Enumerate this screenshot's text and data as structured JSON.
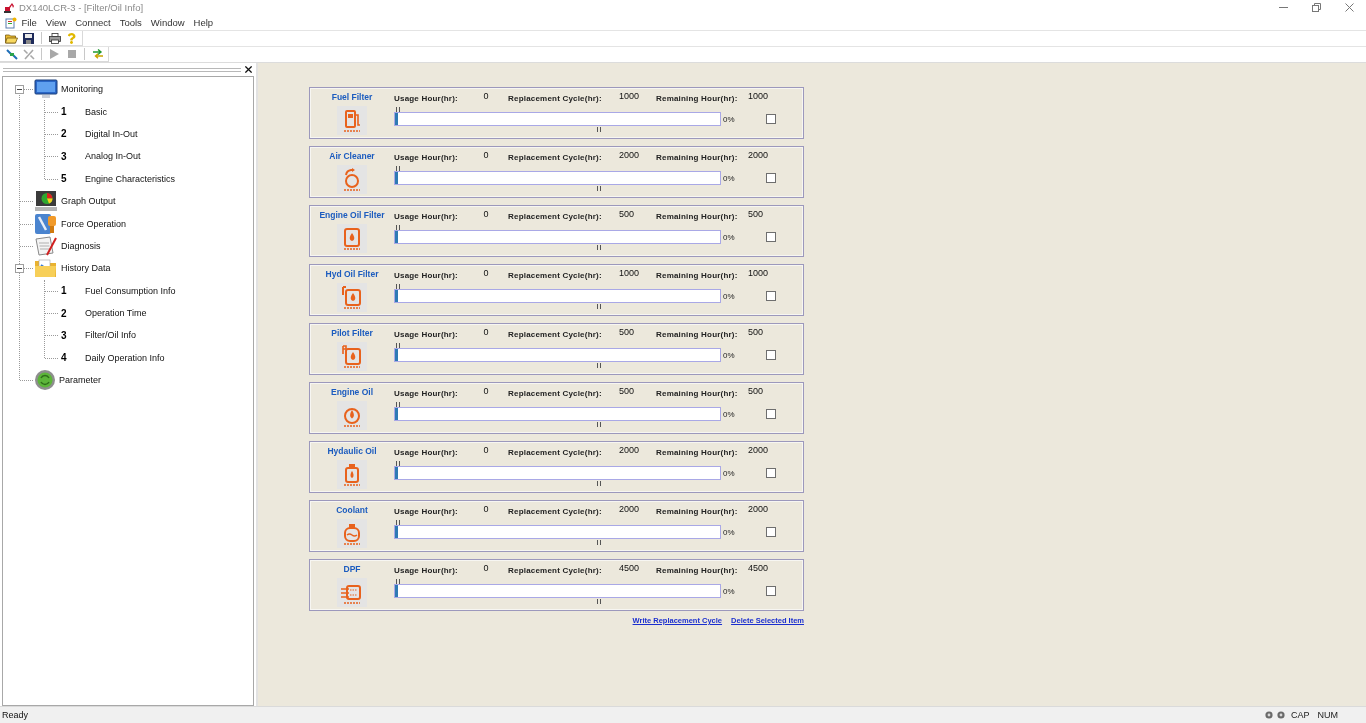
{
  "window": {
    "title": "DX140LCR-3 - [Filter/Oil Info]"
  },
  "menu": [
    "File",
    "View",
    "Connect",
    "Tools",
    "Window",
    "Help"
  ],
  "toolbar": {
    "buttons": [
      {
        "disabled": false
      },
      {
        "disabled": true
      },
      {
        "disabled": true
      },
      {
        "disabled": true
      },
      {
        "disabled": false
      }
    ]
  },
  "sidebar": {
    "tree": [
      {
        "label": "Monitoring",
        "expanded": true,
        "children": [
          {
            "number": "1",
            "label": "Basic"
          },
          {
            "number": "2",
            "label": "Digital In-Out"
          },
          {
            "number": "3",
            "label": "Analog In-Out"
          },
          {
            "number": "5",
            "label": "Engine Characteristics"
          }
        ]
      },
      {
        "label": "Graph Output"
      },
      {
        "label": "Force Operation"
      },
      {
        "label": "Diagnosis"
      },
      {
        "label": "History Data",
        "expanded": true,
        "children": [
          {
            "number": "1",
            "label": "Fuel Consumption Info"
          },
          {
            "number": "2",
            "label": "Operation Time"
          },
          {
            "number": "3",
            "label": "Filter/Oil Info"
          },
          {
            "number": "4",
            "label": "Daily Operation Info"
          }
        ]
      },
      {
        "label": "Parameter"
      }
    ]
  },
  "filters": [
    {
      "name": "Fuel Filter",
      "usage_label": "Usage Hour(hr):",
      "usage": "0",
      "cycle_label": "Replacement Cycle(hr):",
      "cycle": "1000",
      "remaining_label": "Remaining Hour(hr):",
      "remaining": "1000",
      "level": 0.01,
      "percent": "0%",
      "checked": false
    },
    {
      "name": "Air Cleaner",
      "usage_label": "Usage Hour(hr):",
      "usage": "0",
      "cycle_label": "Replacement Cycle(hr):",
      "cycle": "2000",
      "remaining_label": "Remaining Hour(hr):",
      "remaining": "2000",
      "level": 0.01,
      "percent": "0%",
      "checked": false
    },
    {
      "name": "Engine Oil Filter",
      "usage_label": "Usage Hour(hr):",
      "usage": "0",
      "cycle_label": "Replacement Cycle(hr):",
      "cycle": "500",
      "remaining_label": "Remaining Hour(hr):",
      "remaining": "500",
      "level": 0.01,
      "percent": "0%",
      "checked": false
    },
    {
      "name": "Hyd Oil Filter",
      "usage_label": "Usage Hour(hr):",
      "usage": "0",
      "cycle_label": "Replacement Cycle(hr):",
      "cycle": "1000",
      "remaining_label": "Remaining Hour(hr):",
      "remaining": "1000",
      "level": 0.01,
      "percent": "0%",
      "checked": false
    },
    {
      "name": "Pilot Filter",
      "usage_label": "Usage Hour(hr):",
      "usage": "0",
      "cycle_label": "Replacement Cycle(hr):",
      "cycle": "500",
      "remaining_label": "Remaining Hour(hr):",
      "remaining": "500",
      "level": 0.01,
      "percent": "0%",
      "checked": false
    },
    {
      "name": "Engine Oil",
      "usage_label": "Usage Hour(hr):",
      "usage": "0",
      "cycle_label": "Replacement Cycle(hr):",
      "cycle": "500",
      "remaining_label": "Remaining Hour(hr):",
      "remaining": "500",
      "level": 0.01,
      "percent": "0%",
      "checked": false
    },
    {
      "name": "Hydaulic Oil",
      "usage_label": "Usage Hour(hr):",
      "usage": "0",
      "cycle_label": "Replacement Cycle(hr):",
      "cycle": "2000",
      "remaining_label": "Remaining Hour(hr):",
      "remaining": "2000",
      "level": 0.01,
      "percent": "0%",
      "checked": false
    },
    {
      "name": "Coolant",
      "usage_label": "Usage Hour(hr):",
      "usage": "0",
      "cycle_label": "Replacement Cycle(hr):",
      "cycle": "2000",
      "remaining_label": "Remaining Hour(hr):",
      "remaining": "2000",
      "level": 0.01,
      "percent": "0%",
      "checked": false
    },
    {
      "name": "DPF",
      "usage_label": "Usage Hour(hr):",
      "usage": "0",
      "cycle_label": "Replacement Cycle(hr):",
      "cycle": "4500",
      "remaining_label": "Remaining Hour(hr):",
      "remaining": "4500",
      "level": 0.01,
      "percent": "0%",
      "checked": false
    }
  ],
  "links": [
    "Write Replacement Cycle",
    "Delete Selected Item"
  ],
  "status_bar": {
    "text": "Ready",
    "indicators": [
      "CAP",
      "NUM"
    ]
  }
}
